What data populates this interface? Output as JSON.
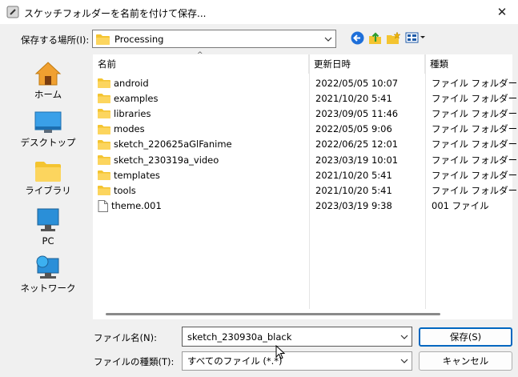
{
  "window": {
    "title": "スケッチフォルダーを名前を付けて保存...",
    "close_glyph": "✕"
  },
  "lookin": {
    "label": "保存する場所(I):",
    "value": "Processing"
  },
  "places": [
    {
      "label": "ホーム",
      "icon": "home-icon"
    },
    {
      "label": "デスクトップ",
      "icon": "desktop-icon"
    },
    {
      "label": "ライブラリ",
      "icon": "library-icon"
    },
    {
      "label": "PC",
      "icon": "pc-icon"
    },
    {
      "label": "ネットワーク",
      "icon": "network-icon"
    }
  ],
  "list": {
    "columns": {
      "name": "名前",
      "date": "更新日時",
      "type": "種類"
    },
    "sort_glyph": "^",
    "rows": [
      {
        "name": "android",
        "date": "2022/05/05 10:07",
        "type": "ファイル フォルダー",
        "icon": "folder-icon"
      },
      {
        "name": "examples",
        "date": "2021/10/20 5:41",
        "type": "ファイル フォルダー",
        "icon": "folder-icon"
      },
      {
        "name": "libraries",
        "date": "2023/09/05 11:46",
        "type": "ファイル フォルダー",
        "icon": "folder-icon"
      },
      {
        "name": "modes",
        "date": "2022/05/05 9:06",
        "type": "ファイル フォルダー",
        "icon": "folder-icon"
      },
      {
        "name": "sketch_220625aGlFanime",
        "date": "2022/06/25 12:01",
        "type": "ファイル フォルダー",
        "icon": "folder-icon"
      },
      {
        "name": "sketch_230319a_video",
        "date": "2023/03/19 10:01",
        "type": "ファイル フォルダー",
        "icon": "folder-icon"
      },
      {
        "name": "templates",
        "date": "2021/10/20 5:41",
        "type": "ファイル フォルダー",
        "icon": "folder-icon"
      },
      {
        "name": "tools",
        "date": "2021/10/20 5:41",
        "type": "ファイル フォルダー",
        "icon": "folder-icon"
      },
      {
        "name": "theme.001",
        "date": "2023/03/19 9:38",
        "type": "001 ファイル",
        "icon": "file-icon"
      }
    ]
  },
  "filename": {
    "label": "ファイル名(N):",
    "value": "sketch_230930a_black"
  },
  "filetype": {
    "label": "ファイルの種類(T):",
    "value": "すべてのファイル (*.*)"
  },
  "buttons": {
    "save": "保存(S)",
    "cancel": "キャンセル"
  },
  "colors": {
    "folder": "#f4c430",
    "accent": "#0067c0"
  }
}
